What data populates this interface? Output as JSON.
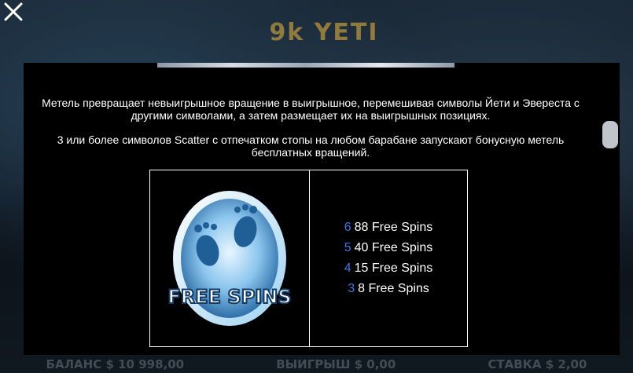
{
  "background": {
    "logo_text": "9k YETI",
    "footer": [
      {
        "label": "БАЛАНС",
        "value": "$ 10 998,00"
      },
      {
        "label": "ВЫИГРЫШ",
        "value": "$ 0,00"
      },
      {
        "label": "СТАВКА",
        "value": "$ 2,00"
      }
    ]
  },
  "close_icon": "close-icon",
  "rules": {
    "paragraph_1": "Метель превращает невыигрышное вращение в выигрышное, перемешивая символы Йети и Эвереста с другими символами, а затем размещает их на выигрышных позициях.",
    "paragraph_2": "3 или более символов Scatter с отпечатком стопы на любом барабане запускают бонусную метель бесплатных вращений.",
    "symbol": {
      "text": "FREE SPINS"
    },
    "payouts": [
      {
        "count": "6",
        "text": "88 Free Spins"
      },
      {
        "count": "5",
        "text": "40 Free Spins"
      },
      {
        "count": "4",
        "text": "15 Free Spins"
      },
      {
        "count": "3",
        "text": "8 Free Spins"
      }
    ]
  },
  "colors": {
    "panel_bg": "#000000",
    "count_blue": "#3a78e6",
    "text": "#ffffff",
    "scroll_thumb": "#bfc5ca"
  }
}
